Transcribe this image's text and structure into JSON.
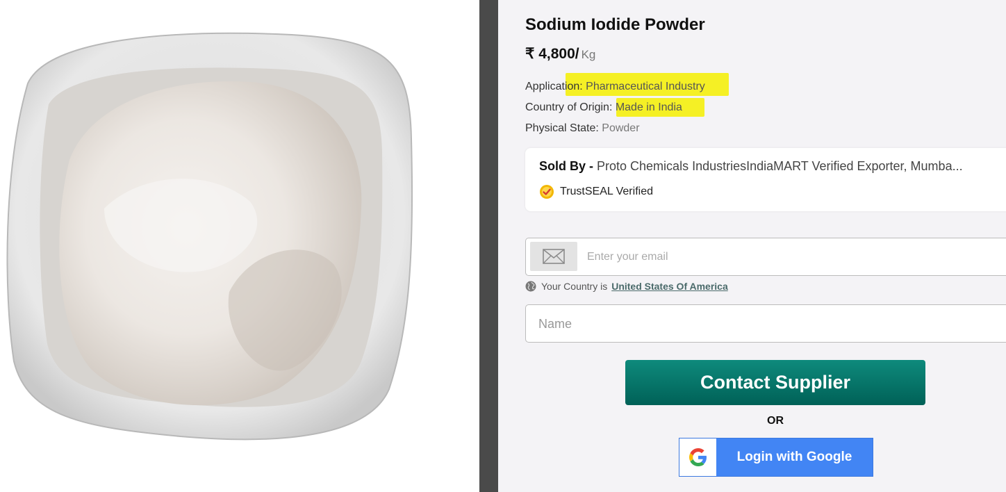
{
  "product": {
    "title": "Sodium Iodide Powder",
    "price": "₹ 4,800/",
    "unit": "Kg",
    "specs": [
      {
        "label": "Application: ",
        "value": "Pharmaceutical Industry"
      },
      {
        "label": "Country of Origin: ",
        "value": "Made in India"
      },
      {
        "label": "Physical State: ",
        "value": "Powder"
      }
    ]
  },
  "seller": {
    "prefix": "Sold By - ",
    "name": "Proto Chemicals IndustriesIndiaMART Verified Exporter, Mumba...",
    "trust_label": "TrustSEAL Verified",
    "trust_icon": "trustseal-badge-icon"
  },
  "form": {
    "email_placeholder": "Enter your email",
    "email_value": "",
    "email_icon": "envelope-icon",
    "country_prefix": "Your Country is",
    "country_value": "United States Of America",
    "country_icon": "globe-icon",
    "name_placeholder": "Name",
    "name_value": "",
    "contact_button": "Contact Supplier",
    "or_text": "OR",
    "google_button": "Login with Google",
    "google_icon": "google-g-icon"
  },
  "colors": {
    "highlight": "#f5ee00",
    "contact_button": "#00796b",
    "google_button": "#4285f4",
    "divider": "#4a4a4a",
    "panel_bg": "#f4f3f6"
  }
}
